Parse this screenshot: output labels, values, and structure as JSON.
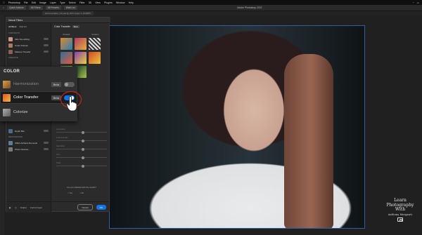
{
  "app": {
    "menubar": [
      "Photoshop",
      "File",
      "Edit",
      "Image",
      "Layer",
      "Type",
      "Select",
      "Filter",
      "3D",
      "View",
      "Plugins",
      "Window",
      "Help"
    ],
    "window_title": "Adobe Photoshop 2022",
    "appbar_items": [
      "Quick Actions",
      "All Filters",
      "All Presets",
      "Wait List"
    ],
    "document_tab": "Harmonization_13.psd @ 25% (Layer 1, RGB/8*)"
  },
  "panel": {
    "title": "Neural Filters",
    "list_tabs": [
      "All filters",
      "Wait list"
    ],
    "sections": {
      "portraits": "Portraits",
      "creative": "Creative",
      "restoration": "Restoration",
      "color": "Color"
    },
    "portrait_items": [
      "Skin Smoothing",
      "Smart Portrait",
      "Makeup Transfer"
    ],
    "lower_items": [
      "Depth Blur",
      "JPEG Artifacts Removal",
      "Photo Restora..."
    ],
    "right_title": "Color Transfer",
    "right_badge": "Beta",
    "columns": [
      "Presets",
      "Custom"
    ],
    "sliders": [
      "Luminance",
      "Color Intensity",
      "Saturation",
      "Hue",
      "Scale"
    ],
    "question": "Are you satisfied with the results?",
    "yes": "Yes",
    "no": "No",
    "output_label": "Output",
    "output_value": "Current layer",
    "cancel": "Cancel",
    "ok": "OK"
  },
  "popout": {
    "title": "COLOR",
    "rows": [
      {
        "label": "Harmonization",
        "badge": "Beta",
        "on": false
      },
      {
        "label": "Color Transfer",
        "badge": "Beta",
        "on": true
      },
      {
        "label": "Colorize",
        "badge": "",
        "on": false
      }
    ]
  },
  "watermark": {
    "line1": "Learn",
    "line2": "Photography",
    "line3": "With",
    "line4": "Anthony Morganti"
  },
  "colors": {
    "accent": "#1473e6",
    "highlight_ring": "#d9261c"
  }
}
